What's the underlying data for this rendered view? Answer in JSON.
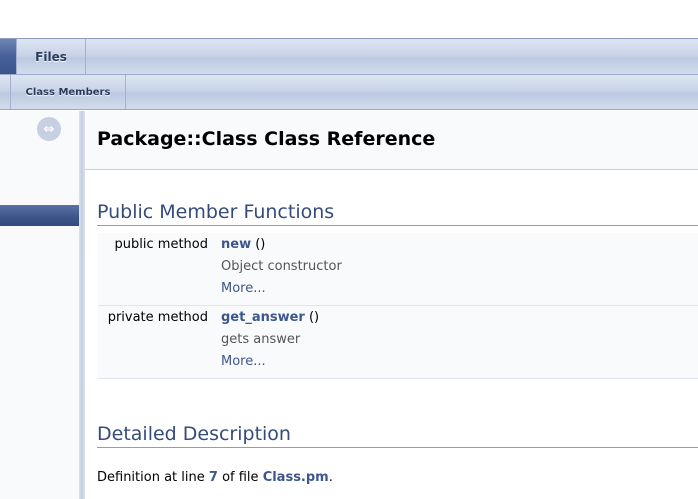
{
  "tabs": {
    "top": [
      {
        "label": "Files",
        "selected": false
      }
    ],
    "second": [
      {
        "label": "Class Members",
        "selected": false
      }
    ]
  },
  "sidenav": {
    "sync_icon": "sync-arrows-icon"
  },
  "header": {
    "title": "Package::Class Class Reference"
  },
  "sections": {
    "public_member_functions": "Public Member Functions",
    "detailed_description": "Detailed Description"
  },
  "members": [
    {
      "type": "public method",
      "name": "new",
      "parens": "()",
      "description": "Object constructor",
      "more": "More..."
    },
    {
      "type": "private method",
      "name": "get_answer",
      "parens": "()",
      "description": "gets answer",
      "more": "More..."
    }
  ],
  "definition": {
    "prefix": "Definition at line",
    "line": "7",
    "middle": "of file",
    "file": "Class.pm",
    "suffix": "."
  },
  "colors": {
    "link": "#3d578c",
    "heading": "#354c7b",
    "selected_tab": "#46609a"
  }
}
